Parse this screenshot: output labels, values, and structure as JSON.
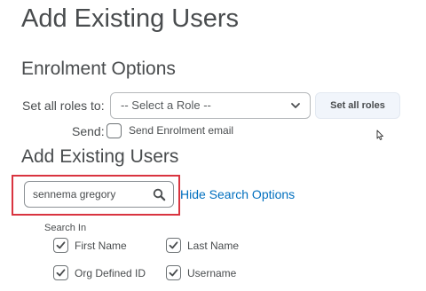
{
  "header": {
    "title": "Add Existing Users"
  },
  "enrolment": {
    "title": "Enrolment Options",
    "roles_label": "Set all roles to:",
    "role_select": {
      "selected": "-- Select a Role --",
      "icon": "chevron-down-icon"
    },
    "set_roles_button": "Set all roles",
    "send_label": "Send:",
    "send_email": {
      "label": "Send Enrolment email",
      "checked": false
    }
  },
  "add_users": {
    "title": "Add Existing Users",
    "search": {
      "value": "sennema gregory",
      "icon": "search-icon"
    },
    "hide_search_link": "Hide Search Options",
    "search_in_label": "Search In",
    "options": [
      {
        "label": "First Name",
        "checked": true
      },
      {
        "label": "Last Name",
        "checked": true
      },
      {
        "label": "Org Defined ID",
        "checked": true
      },
      {
        "label": "Username",
        "checked": true
      }
    ]
  },
  "colors": {
    "highlight": "#d9343f",
    "link": "#006fbf",
    "text": "#494c4e"
  }
}
